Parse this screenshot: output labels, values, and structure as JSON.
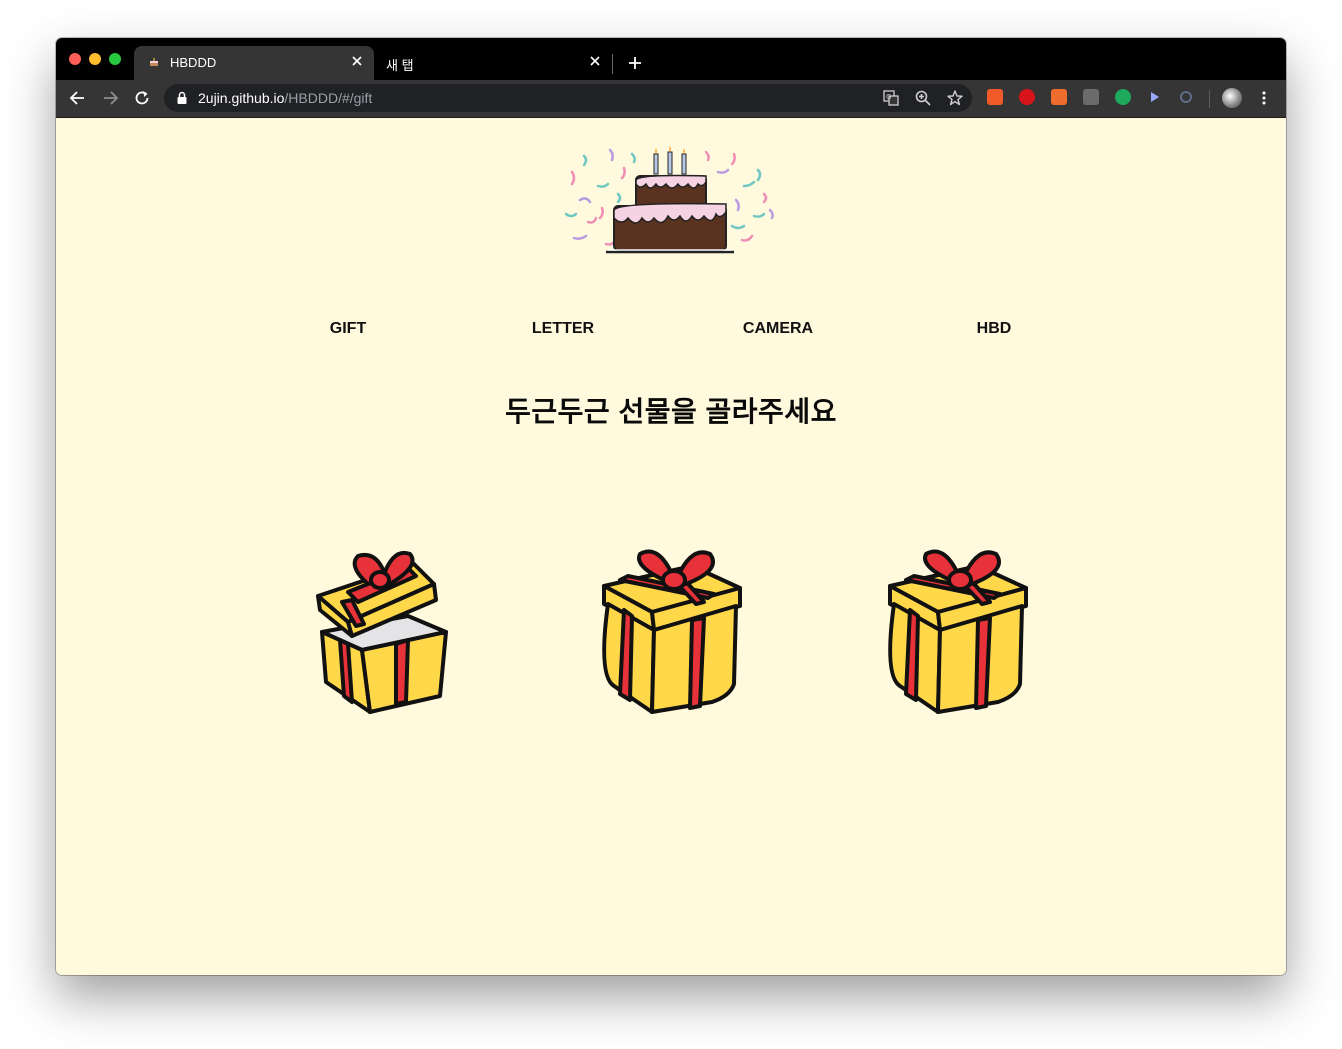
{
  "browser": {
    "tabs": [
      {
        "title": "HBDDD",
        "active": true
      },
      {
        "title": "새 탭",
        "active": false
      }
    ],
    "url": {
      "host": "2ujin.github.io",
      "path": "/HBDDD/#/gift"
    }
  },
  "page": {
    "nav": [
      {
        "label": "GIFT"
      },
      {
        "label": "LETTER"
      },
      {
        "label": "CAMERA"
      },
      {
        "label": "HBD"
      }
    ],
    "heading": "두근두근 선물을 골라주세요",
    "gifts": [
      {
        "state": "open"
      },
      {
        "state": "closed"
      },
      {
        "state": "closed"
      }
    ]
  },
  "colors": {
    "background": "#fff9dd",
    "gift_yellow": "#ffd84a",
    "ribbon_red": "#e8323a",
    "cake_brown": "#5a3320",
    "frosting": "#f6d3e2"
  },
  "icons": {
    "extensions": [
      "ex-extension-icon",
      "adblock-icon",
      "layout-extension-icon",
      "i-extension-icon",
      "evernote-icon",
      "cursor-extension-icon",
      "recycle-extension-icon"
    ]
  }
}
